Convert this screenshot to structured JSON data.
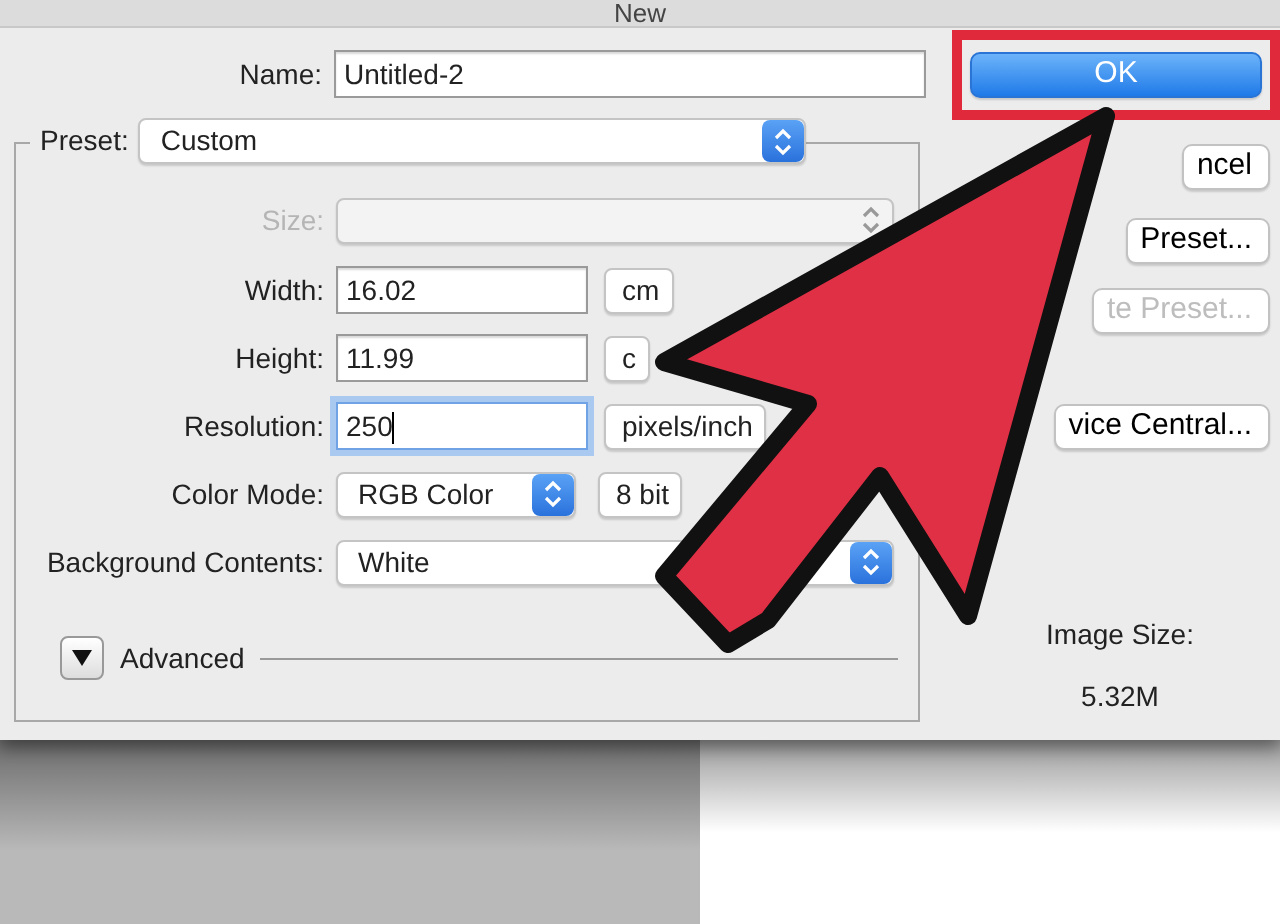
{
  "window": {
    "title": "New"
  },
  "name": {
    "label": "Name:",
    "value": "Untitled-2"
  },
  "preset": {
    "label": "Preset:",
    "value": "Custom"
  },
  "fields": [
    {
      "kind": "dropdown",
      "label": "Size:",
      "disabled": true
    },
    {
      "kind": "measure",
      "label": "Width:",
      "value": "16.02",
      "unit": "cm",
      "focused": false
    },
    {
      "kind": "measure",
      "label": "Height:",
      "value": "11.99",
      "unit": "c",
      "focused": false
    },
    {
      "kind": "measure",
      "label": "Resolution:",
      "value": "250",
      "unit": "pixels/inch",
      "focused": true
    },
    {
      "kind": "pair",
      "label": "Color Mode:",
      "value": "RGB Color",
      "second": "8 bit"
    },
    {
      "kind": "dropdown",
      "label": "Background Contents:",
      "value": "White",
      "disabled": false
    }
  ],
  "advanced": {
    "label": "Advanced",
    "expanded": false
  },
  "buttons": [
    {
      "label": "OK",
      "default": true,
      "disabled": false,
      "highlighted": true
    },
    {
      "label": "ncel",
      "default": false,
      "disabled": false,
      "highlighted": false
    },
    {
      "label": "Preset...",
      "default": false,
      "disabled": false,
      "highlighted": false
    },
    {
      "label": "te Preset...",
      "default": false,
      "disabled": true,
      "highlighted": false
    },
    {
      "label": "vice Central...",
      "default": false,
      "disabled": false,
      "highlighted": false
    }
  ],
  "image_size": {
    "label": "Image Size:",
    "value": "5.32M"
  }
}
